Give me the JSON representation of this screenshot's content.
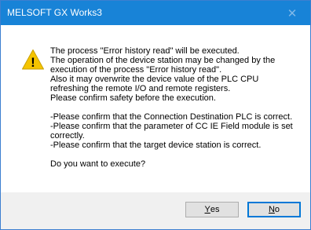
{
  "window": {
    "title": "MELSOFT GX Works3",
    "close_glyph": "✕"
  },
  "icon": {
    "name": "warning-icon",
    "glyph": "!",
    "color": "#f5c400"
  },
  "message": {
    "lines": [
      "The process \"Error history read\" will be executed.",
      "The operation of the device station may be changed by the",
      "execution of the process \"Error history read\".",
      "Also it may overwrite the device value of the PLC CPU",
      "refreshing the remote I/O and remote registers.",
      "Please confirm safety before the execution.",
      "",
      "-Please confirm that the Connection Destination PLC is correct.",
      "-Please confirm that the parameter of CC IE Field module is set",
      "correctly.",
      "-Please confirm that the target device station is correct.",
      "",
      "Do you want to execute?"
    ]
  },
  "buttons": {
    "yes": {
      "mnemonic": "Y",
      "rest": "es"
    },
    "no": {
      "mnemonic": "N",
      "rest": "o"
    }
  },
  "colors": {
    "titlebar": "#1883d7",
    "default_button_border": "#0078d7"
  }
}
